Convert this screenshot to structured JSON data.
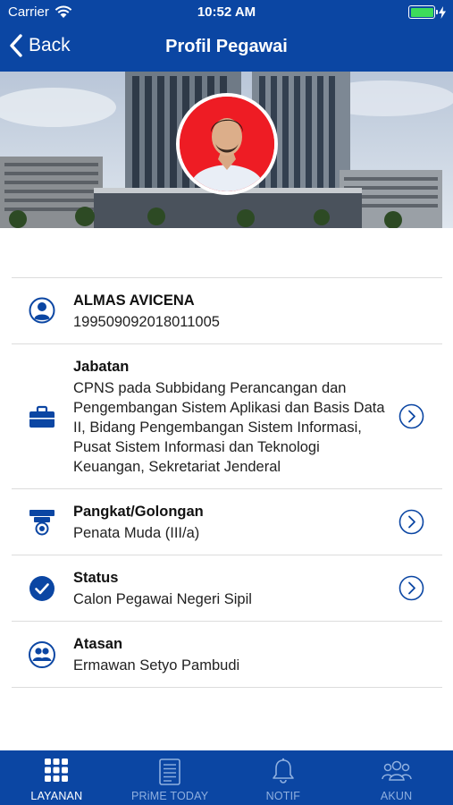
{
  "status_bar": {
    "carrier": "Carrier",
    "time": "10:52 AM",
    "battery_color": "#3ddc5a"
  },
  "nav": {
    "back_label": "Back",
    "title": "Profil Pegawai"
  },
  "profile": {
    "name": "ALMAS AVICENA",
    "nip": "199509092018011005",
    "items": [
      {
        "label": "Jabatan",
        "value": "CPNS pada Subbidang Perancangan dan Pengembangan Sistem Aplikasi dan Basis Data II, Bidang Pengembangan Sistem Informasi, Pusat Sistem Informasi dan Teknologi Keuangan, Sekretariat Jenderal",
        "icon": "briefcase-icon"
      },
      {
        "label": "Pangkat/Golongan",
        "value": "Penata Muda (III/a)",
        "icon": "rank-insignia-icon"
      },
      {
        "label": "Status",
        "value": "Calon Pegawai Negeri Sipil",
        "icon": "check-circle-icon"
      },
      {
        "label": "Atasan",
        "value": "Ermawan Setyo Pambudi",
        "icon": "people-icon"
      }
    ]
  },
  "tabs": [
    {
      "label": "LAYANAN",
      "icon": "grid-icon",
      "active": true
    },
    {
      "label": "PRiME TODAY",
      "icon": "document-icon",
      "active": false
    },
    {
      "label": "NOTIF",
      "icon": "bell-icon",
      "active": false
    },
    {
      "label": "AKUN",
      "icon": "group-icon",
      "active": false
    }
  ],
  "colors": {
    "primary": "#0b46a3",
    "tab_inactive": "#8fb0e0",
    "avatar_bg": "#ee1c24"
  }
}
